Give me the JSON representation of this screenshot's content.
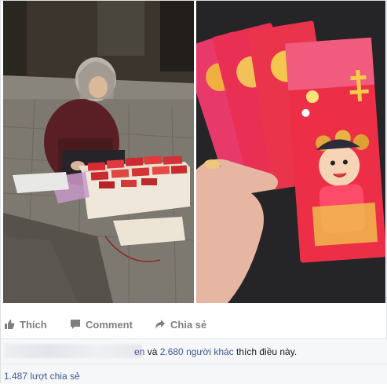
{
  "post": {
    "photos": [
      {
        "name": "left-photo"
      },
      {
        "name": "right-photo"
      }
    ]
  },
  "actions": {
    "like_label": "Thích",
    "comment_label": "Comment",
    "share_label": "Chia sẻ"
  },
  "likes": {
    "name_suffix": "en",
    "connector": " và ",
    "others_link": "2.680 người khác",
    "tail": " thích điều này."
  },
  "shares": {
    "count_text": "1.487 lượt chia sẻ"
  },
  "colors": {
    "link": "#3b5998",
    "action_gray": "#7f7f7f",
    "row_bg": "#f6f7f9"
  },
  "icons": [
    "like-icon",
    "comment-icon",
    "share-icon"
  ]
}
